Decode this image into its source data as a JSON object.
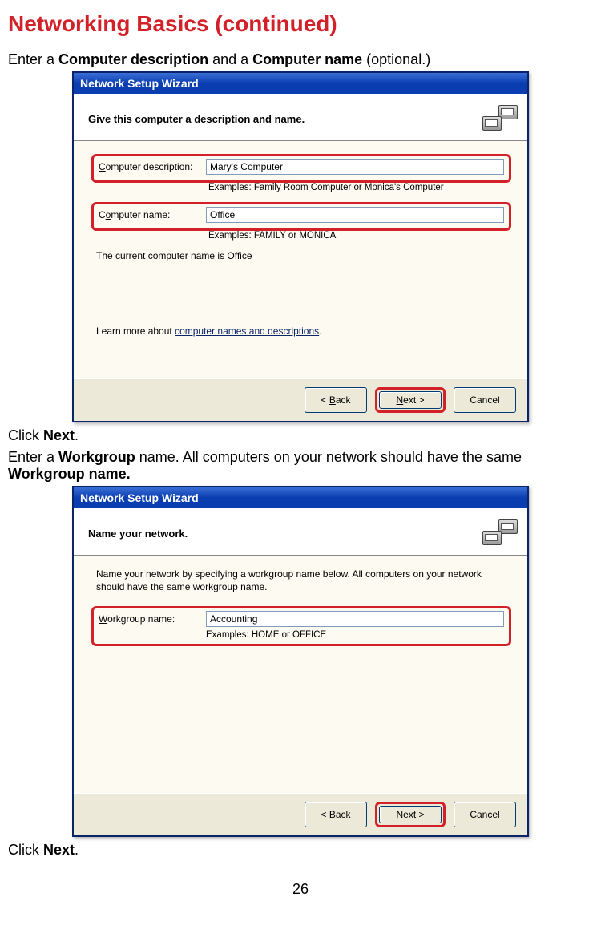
{
  "page": {
    "title": "Networking Basics (continued)",
    "number": "26"
  },
  "instr1_pre": "Enter a ",
  "instr1_b1": "Computer description",
  "instr1_mid": " and a ",
  "instr1_b2": "Computer name",
  "instr1_post": " (optional.)",
  "click_next": "Click ",
  "next_bold": "Next",
  "period": ".",
  "instr2_pre": "Enter a ",
  "instr2_b1": "Workgroup",
  "instr2_mid": " name. All computers on your network should have the same ",
  "instr2_b2": "Workgroup name.",
  "wizard1": {
    "title": "Network Setup Wizard",
    "heading": "Give this computer a description and name.",
    "desc_label": "Computer description:",
    "desc_value": "Mary's Computer",
    "desc_hint": "Examples: Family Room Computer or Monica's Computer",
    "name_label": "Computer name:",
    "name_value": "Office",
    "name_hint": "Examples: FAMILY or MONICA",
    "current": "The current computer name is Office",
    "learn_pre": "Learn more about ",
    "learn_link": "computer names and descriptions",
    "back": "< Back",
    "next": "Next >",
    "cancel": "Cancel"
  },
  "wizard2": {
    "title": "Network Setup Wizard",
    "heading": "Name your network.",
    "intro": "Name your network by specifying a workgroup name below. All computers on your network should have the same workgroup name.",
    "wg_label": "Workgroup name:",
    "wg_value": "Accounting",
    "wg_hint": "Examples: HOME or OFFICE",
    "back": "< Back",
    "next": "Next >",
    "cancel": "Cancel"
  }
}
